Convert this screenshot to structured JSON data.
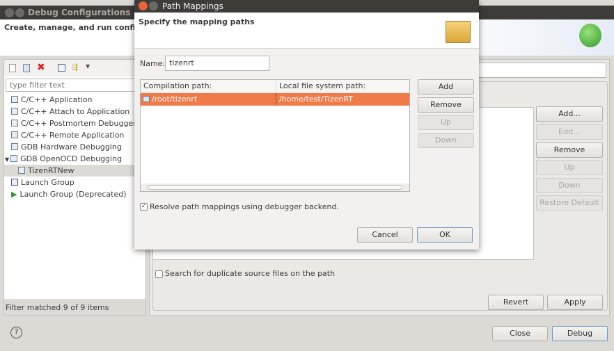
{
  "main": {
    "title": "Debug Configurations",
    "header": "Create, manage, and run configurations",
    "filter_placeholder": "type filter text",
    "tree": [
      {
        "label": "C/C++ Application"
      },
      {
        "label": "C/C++ Attach to Application"
      },
      {
        "label": "C/C++ Postmortem Debugger"
      },
      {
        "label": "C/C++ Remote Application"
      },
      {
        "label": "GDB Hardware Debugging"
      },
      {
        "label": "GDB OpenOCD Debugging"
      },
      {
        "label": "TizenRTNew"
      },
      {
        "label": "Launch Group"
      },
      {
        "label": "Launch Group (Deprecated)"
      }
    ],
    "filter_status": "Filter matched 9 of 9 items",
    "right_buttons": {
      "add": "Add...",
      "edit": "Edit...",
      "remove": "Remove",
      "up": "Up",
      "down": "Down",
      "restore": "Restore Default"
    },
    "search_duplicates": "Search for duplicate source files on the path",
    "revert": "Revert",
    "apply": "Apply",
    "close": "Close",
    "debug": "Debug",
    "help": "?"
  },
  "dialog": {
    "title": "Path Mappings",
    "header": "Specify the mapping paths",
    "name_label": "Name:",
    "name_value": "tizenrt",
    "columns": [
      "Compilation path:",
      "Local file system path:"
    ],
    "rows": [
      {
        "compilation": "/root/tizenrt",
        "local": "/home/test/TizenRT"
      }
    ],
    "buttons": {
      "add": "Add",
      "remove": "Remove",
      "up": "Up",
      "down": "Down"
    },
    "resolve_label": "Resolve path mappings using debugger backend.",
    "resolve_checked": true,
    "cancel": "Cancel",
    "ok": "OK",
    "selection_color": "#f07a48"
  }
}
